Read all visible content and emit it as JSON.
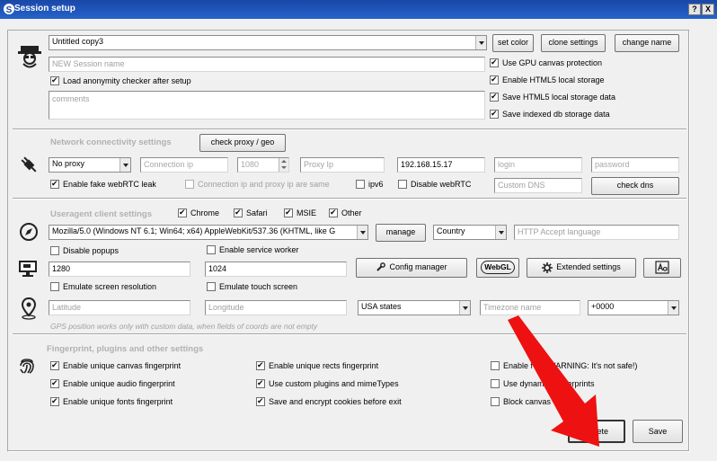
{
  "window": {
    "title": "Session setup",
    "help_label": "?",
    "close_label": "X"
  },
  "general": {
    "session_name_value": "Untitled copy3",
    "new_session_placeholder": "NEW Session name",
    "set_color_label": "set color",
    "clone_settings_label": "clone settings",
    "change_name_label": "change name",
    "load_anonymity_checker_label": "Load anonymity checker after setup",
    "comments_placeholder": "comments",
    "gpu_canvas_protection_label": "Use GPU canvas protection",
    "enable_html5_storage_label": "Enable HTML5 local storage",
    "save_html5_storage_label": "Save HTML5 local storage data",
    "save_indexed_db_label": "Save indexed db storage data"
  },
  "network": {
    "section_title": "Network connectivity settings",
    "check_proxy_label": "check proxy / geo",
    "proxy_type_value": "No proxy",
    "connection_ip_placeholder": "Connection ip",
    "port_value": "1080",
    "proxy_ip_placeholder": "Proxy Ip",
    "local_ip_value": "192.168.15.17",
    "login_placeholder": "login",
    "password_placeholder": "password",
    "enable_fake_webrtc_label": "Enable fake webRTC leak",
    "connection_ip_same_label": "Connection ip and proxy ip are same",
    "ipv6_label": "ipv6",
    "disable_webrtc_label": "Disable webRTC",
    "custom_dns_placeholder": "Custom DNS",
    "check_dns_label": "check dns"
  },
  "useragent": {
    "section_title": "Useragent client settings",
    "chrome_label": "Chrome",
    "safari_label": "Safari",
    "msie_label": "MSIE",
    "other_label": "Other",
    "ua_value": "Mozilla/5.0 (Windows NT 6.1; Win64; x64) AppleWebKit/537.36 (KHTML, like G",
    "manage_label": "manage",
    "country_value": "Country",
    "http_accept_placeholder": "HTTP Accept language",
    "disable_popups_label": "Disable popups",
    "enable_service_worker_label": "Enable service worker",
    "width_value": "1280",
    "height_value": "1024",
    "config_manager_label": "Config manager",
    "webgl_label": "WebGL",
    "extended_settings_label": "Extended settings",
    "emulate_resolution_label": "Emulate screen resolution",
    "emulate_touch_label": "Emulate touch screen"
  },
  "gps": {
    "latitude_placeholder": "Latitude",
    "longitude_placeholder": "Longitude",
    "states_value": "USA states",
    "timezone_placeholder": "Timezone name",
    "offset_value": "+0000",
    "note": "GPS position works only with custom data, when fields of coords are not empty"
  },
  "fingerprint": {
    "section_title": "Fingerprint, plugins and other settings",
    "canvas_label": "Enable unique canvas fingerprint",
    "audio_label": "Enable unique audio fingerprint",
    "fonts_label": "Enable unique fonts fingerprint",
    "rects_label": "Enable unique rects fingerprint",
    "plugins_label": "Use custom plugins and mimeTypes",
    "cookies_label": "Save and encrypt cookies before exit",
    "flash_label": "Enable f",
    "flash_warning": "(WARNING: It's not safe!)",
    "dynamic_label": "Use dynam",
    "dynamic_suffix": "erprints",
    "block_canvas_label": "Block canvas"
  },
  "footer": {
    "delete_label": "Delete",
    "save_label": "Save"
  },
  "colors": {
    "titlebar": "#1a47a8",
    "annotation_arrow": "#ee1111"
  }
}
